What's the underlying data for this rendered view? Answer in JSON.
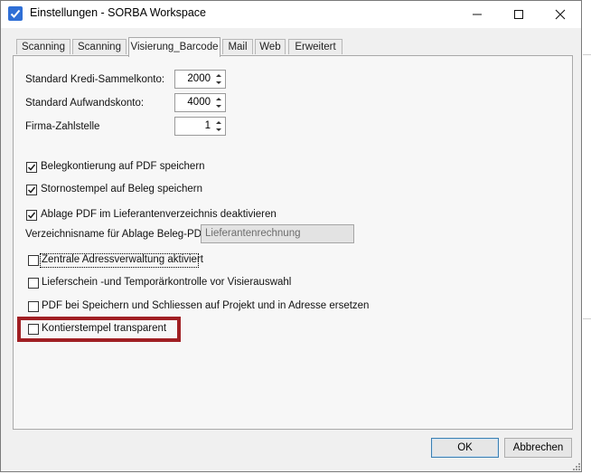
{
  "window": {
    "title": "Einstellungen - SORBA Workspace",
    "minimize_icon": "minimize-icon",
    "maximize_icon": "maximize-icon",
    "close_icon": "close-icon",
    "close_label": "✕"
  },
  "tabs": [
    {
      "label": "Scanning",
      "active": false
    },
    {
      "label": "Scanning",
      "active": false
    },
    {
      "label": "Visierung_Barcode",
      "active": true
    },
    {
      "label": "Mail",
      "active": false
    },
    {
      "label": "Web",
      "active": false
    },
    {
      "label": "Erweitert",
      "active": false
    }
  ],
  "fields": {
    "kredi_label": "Standard Kredi-Sammelkonto:",
    "kredi_value": "2000",
    "aufwand_label": "Standard Aufwandskonto:",
    "aufwand_value": "4000",
    "zahlstelle_label": "Firma-Zahlstelle",
    "zahlstelle_value": "1"
  },
  "checkboxes": [
    {
      "label": "Belegkontierung auf PDF speichern",
      "checked": true
    },
    {
      "label": "Stornostempel auf Beleg speichern",
      "checked": true
    },
    {
      "label": "Ablage PDF im Lieferantenverzeichnis deaktivieren",
      "checked": true
    },
    {
      "label": "Zentrale Adressverwaltung aktiviert",
      "checked": false
    },
    {
      "label": "Lieferschein -und Temporärkontrolle vor Visierauswahl",
      "checked": false
    },
    {
      "label": "PDF bei Speichern und Schliessen auf Projekt und in Adresse ersetzen",
      "checked": false
    },
    {
      "label": "Kontierstempel transparent",
      "checked": false
    }
  ],
  "verzeichnis": {
    "label": "Verzeichnisname für Ablage Beleg-PDF:",
    "value": "Lieferantenrechnung"
  },
  "buttons": {
    "ok": "OK",
    "cancel": "Abbrechen"
  },
  "colors": {
    "highlight": "#a01f23",
    "app_icon": "#2f6fd6"
  }
}
